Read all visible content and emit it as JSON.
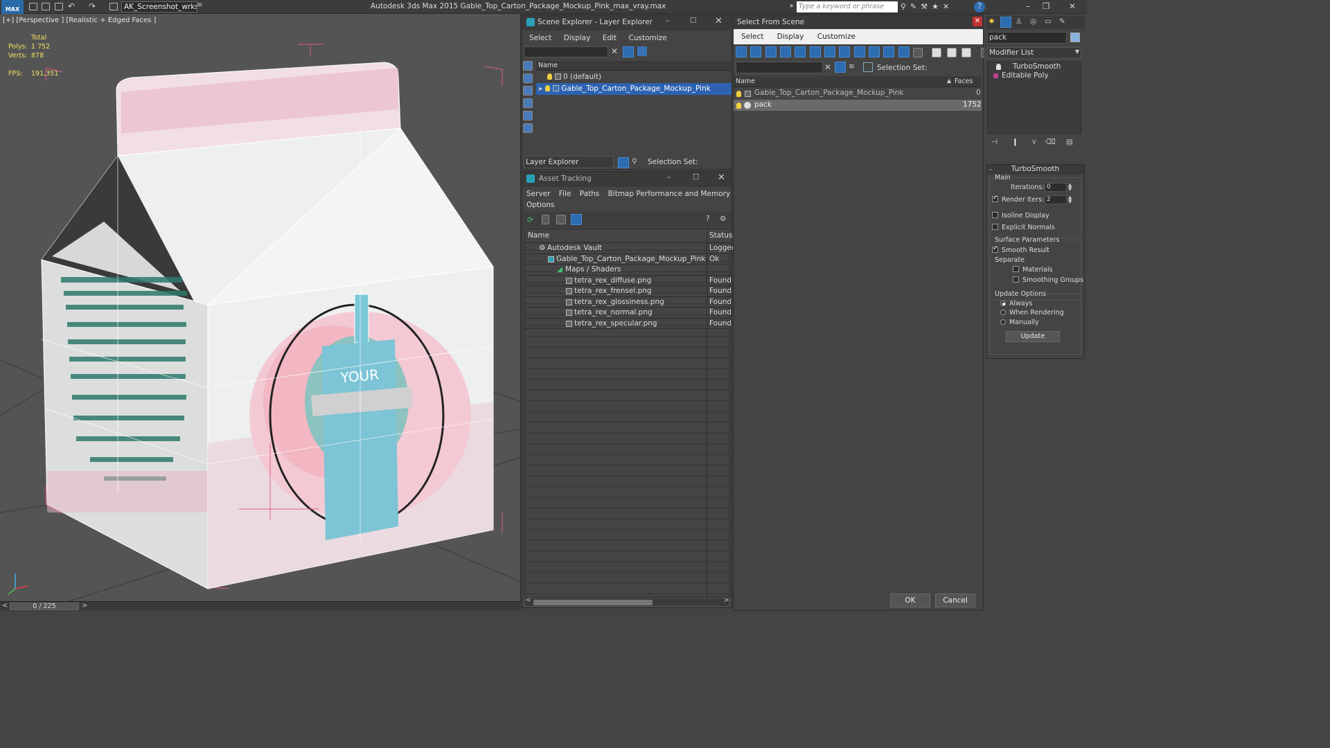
{
  "app": {
    "logo": "MAX",
    "workspace": "AK_Screenshot_wrksp",
    "title": "Autodesk 3ds Max  2015    Gable_Top_Carton_Package_Mockup_Pink_max_vray.max",
    "search_placeholder": "Type a keyword or phrase"
  },
  "viewport": {
    "label": "[+] [Perspective ] [Realistic + Edged Faces ]",
    "stats_total": "Total",
    "polys_label": "Polys:",
    "polys_value": "1 752",
    "verts_label": "Verts:",
    "verts_value": "878",
    "fps_label": "FPS:",
    "fps_value": "191,351",
    "time_slider": "0 / 225"
  },
  "scene_explorer": {
    "title": "Scene Explorer - Layer Explorer",
    "menus": [
      "Select",
      "Display",
      "Edit",
      "Customize"
    ],
    "col_name": "Name",
    "rows": [
      "0 (default)",
      "Gable_Top_Carton_Package_Mockup_Pink"
    ],
    "footer_dropdown": "Layer Explorer",
    "footer_selection_set": "Selection Set:"
  },
  "asset_tracking": {
    "title": "Asset Tracking",
    "menus": [
      "Server",
      "File",
      "Paths",
      "Bitmap Performance and Memory"
    ],
    "menu_options": "Options",
    "col_name": "Name",
    "col_status": "Status",
    "rows": [
      {
        "name": "Autodesk Vault",
        "status": "Logged"
      },
      {
        "name": "Gable_Top_Carton_Package_Mockup_Pink_max...",
        "status": "Ok"
      },
      {
        "name": "Maps / Shaders",
        "status": ""
      },
      {
        "name": "tetra_rex_diffuse.png",
        "status": "Found"
      },
      {
        "name": "tetra_rex_frensel.png",
        "status": "Found"
      },
      {
        "name": "tetra_rex_glossiness.png",
        "status": "Found"
      },
      {
        "name": "tetra_rex_normal.png",
        "status": "Found"
      },
      {
        "name": "tetra_rex_specular.png",
        "status": "Found"
      }
    ]
  },
  "select_from_scene": {
    "title": "Select From Scene",
    "menus": [
      "Select",
      "Display",
      "Customize"
    ],
    "selection_set": "Selection Set:",
    "col_name": "Name",
    "col_faces": "Faces",
    "rows": [
      {
        "name": "Gable_Top_Carton_Package_Mockup_Pink",
        "faces": "0"
      },
      {
        "name": "pack",
        "faces": "1752"
      }
    ],
    "ok": "OK",
    "cancel": "Cancel"
  },
  "modify_panel": {
    "object_name": "pack",
    "modifier_list": "Modifier List",
    "stack": [
      "TurboSmooth",
      "Editable Poly"
    ],
    "rollout_title": "TurboSmooth",
    "main": "Main",
    "iterations_label": "Iterations:",
    "iterations_value": "0",
    "render_iters_label": "Render Iters:",
    "render_iters_value": "2",
    "isoline_display": "Isoline Display",
    "explicit_normals": "Explicit Normals",
    "surface_parameters": "Surface Parameters",
    "smooth_result": "Smooth Result",
    "separate": "Separate",
    "materials": "Materials",
    "smoothing_groups": "Smoothing Groups",
    "update_options": "Update Options",
    "always": "Always",
    "when_rendering": "When Rendering",
    "manually": "Manually",
    "update_button": "Update"
  }
}
